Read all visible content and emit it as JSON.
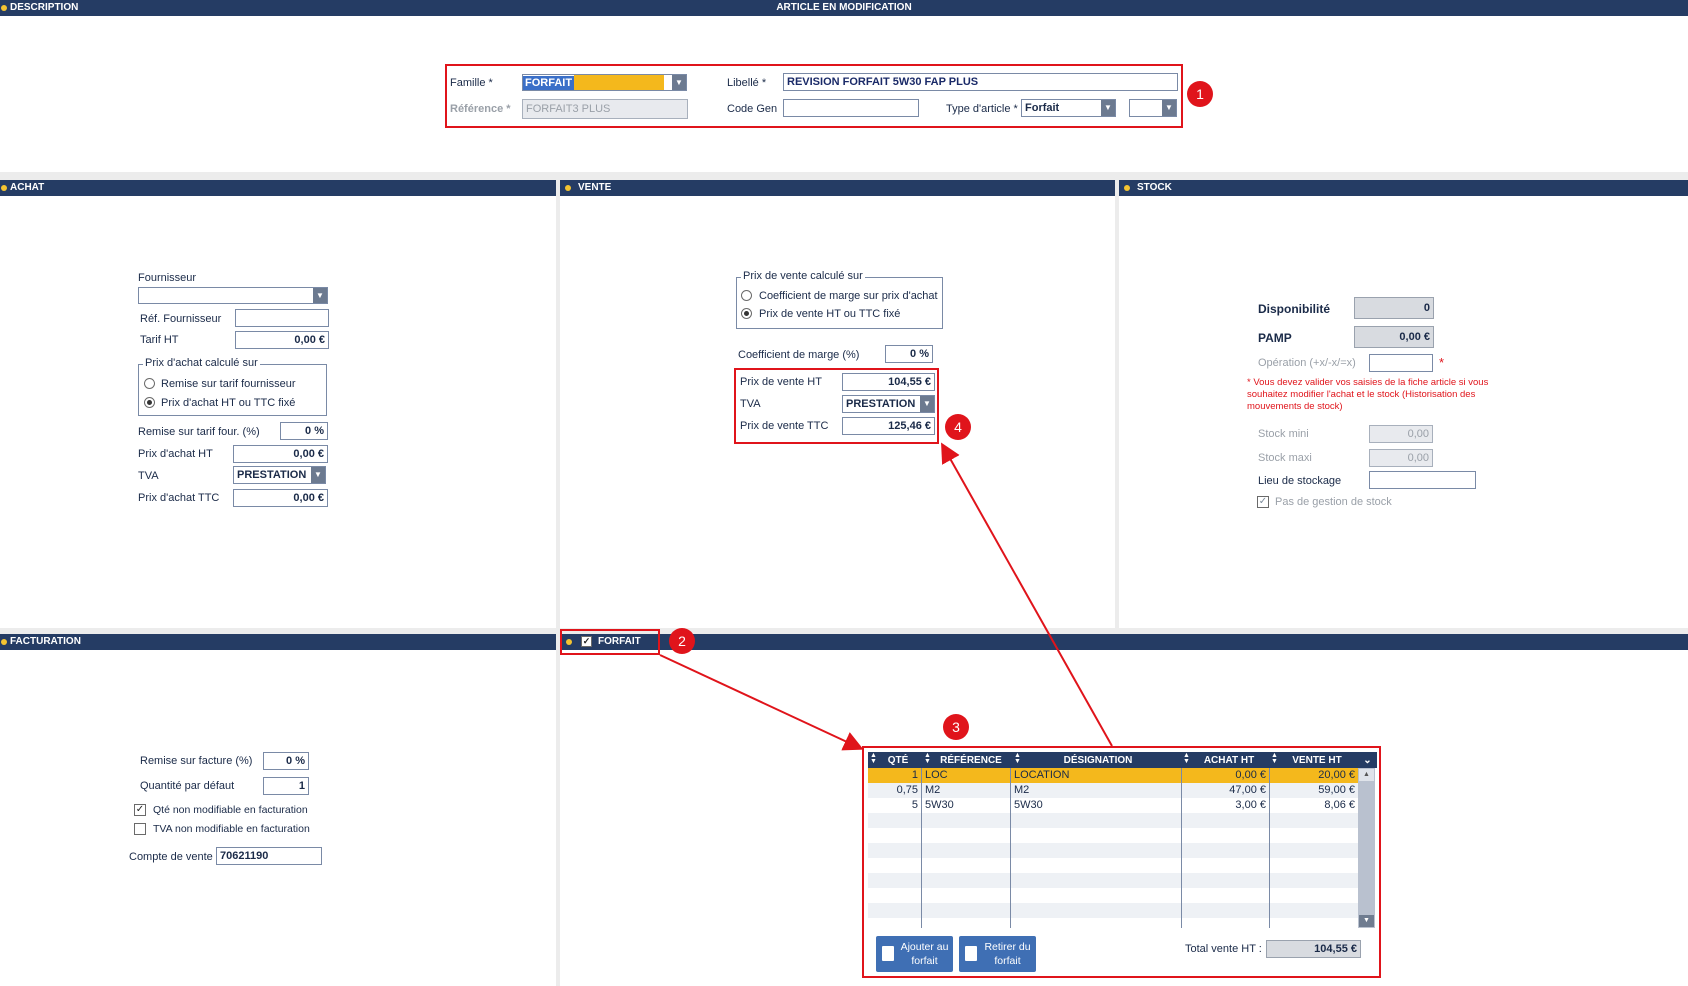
{
  "description": {
    "header": "DESCRIPTION",
    "center_title": "ARTICLE EN MODIFICATION",
    "famille_label": "Famille *",
    "famille_value": "FORFAIT",
    "libelle_label": "Libellé *",
    "libelle_value": "REVISION FORFAIT 5W30 FAP PLUS",
    "reference_label": "Référence *",
    "reference_value": "FORFAIT3 PLUS",
    "code_gen_label": "Code Gen",
    "code_gen_value": "",
    "type_article_label": "Type d'article *",
    "type_article_value": "Forfait",
    "extra_select_value": ""
  },
  "achat": {
    "header": "ACHAT",
    "fournisseur_label": "Fournisseur",
    "fournisseur_value": "",
    "ref_fournisseur_label": "Réf. Fournisseur",
    "ref_fournisseur_value": "",
    "tarif_ht_label": "Tarif HT",
    "tarif_ht_value": "0,00 €",
    "calc_group_label": "Prix d'achat calculé sur",
    "radio_remise": "Remise sur tarif fournisseur",
    "radio_prix": "Prix d'achat HT ou TTC fixé",
    "remise_label": "Remise sur tarif four. (%)",
    "remise_value": "0 %",
    "prix_achat_ht_label": "Prix d'achat HT",
    "prix_achat_ht_value": "0,00 €",
    "tva_label": "TVA",
    "tva_value": "PRESTATION",
    "prix_achat_ttc_label": "Prix d'achat TTC",
    "prix_achat_ttc_value": "0,00 €"
  },
  "vente": {
    "header": "VENTE",
    "calc_group_label": "Prix de vente calculé sur",
    "radio_coef": "Coefficient de marge sur prix d'achat",
    "radio_prix": "Prix de vente HT ou TTC fixé",
    "coef_label": "Coefficient de marge (%)",
    "coef_value": "0 %",
    "prix_ht_label": "Prix de vente HT",
    "prix_ht_value": "104,55 €",
    "tva_label": "TVA",
    "tva_value": "PRESTATION",
    "prix_ttc_label": "Prix de vente TTC",
    "prix_ttc_value": "125,46 €"
  },
  "stock": {
    "header": "STOCK",
    "disponibilite_label": "Disponibilité",
    "disponibilite_value": "0",
    "pamp_label": "PAMP",
    "pamp_value": "0,00 €",
    "operation_label": "Opération (+x/-x/=x)",
    "operation_value": "",
    "req_star": "*",
    "warning": "* Vous devez valider vos saisies de la fiche article si vous souhaitez modifier l'achat et le stock (Historisation des mouvements de stock)",
    "stock_mini_label": "Stock mini",
    "stock_mini_value": "0,00",
    "stock_maxi_label": "Stock maxi",
    "stock_maxi_value": "0,00",
    "lieu_label": "Lieu de stockage",
    "lieu_value": "",
    "pas_gestion_label": "Pas de gestion de stock"
  },
  "facturation": {
    "header": "FACTURATION",
    "remise_label": "Remise sur facture (%)",
    "remise_value": "0 %",
    "quantite_label": "Quantité par défaut",
    "quantite_value": "1",
    "qte_non_modif_label": "Qté non modifiable en facturation",
    "tva_non_modif_label": "TVA non modifiable en facturation",
    "compte_label": "Compte de vente",
    "compte_value": "70621190"
  },
  "forfait": {
    "header": "FORFAIT",
    "columns": [
      "QTÉ",
      "RÉFÉRENCE",
      "DÉSIGNATION",
      "ACHAT HT",
      "VENTE HT"
    ],
    "rows": [
      {
        "qte": "1",
        "reference": "LOC",
        "designation": "LOCATION",
        "achat_ht": "0,00 €",
        "vente_ht": "20,00 €"
      },
      {
        "qte": "0,75",
        "reference": "M2",
        "designation": "M2",
        "achat_ht": "47,00 €",
        "vente_ht": "59,00 €"
      },
      {
        "qte": "5",
        "reference": "5W30",
        "designation": "5W30",
        "achat_ht": "3,00 €",
        "vente_ht": "8,06 €"
      }
    ],
    "add_button": "Ajouter au forfait",
    "remove_button": "Retirer du forfait",
    "total_label": "Total vente HT :",
    "total_value": "104,55 €"
  },
  "annotations": {
    "badge1": "1",
    "badge2": "2",
    "badge3": "3",
    "badge4": "4"
  },
  "colors": {
    "header_bg": "#253c64",
    "accent_yellow": "#f4c431",
    "highlight_row": "#f4b81c",
    "annotation_red": "#e0141b"
  }
}
